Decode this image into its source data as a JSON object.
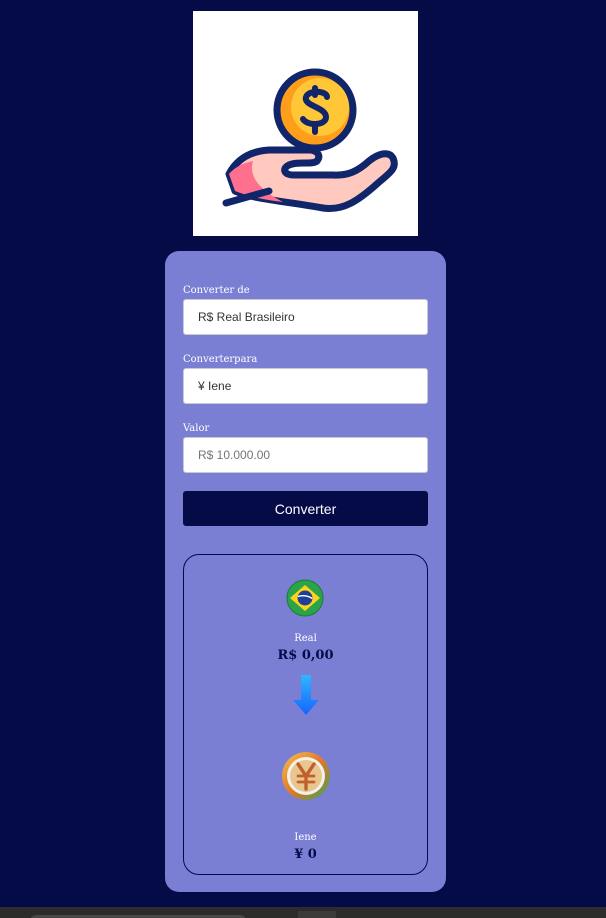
{
  "form": {
    "from_label": "Converter de",
    "from_value": "R$ Real Brasileiro",
    "to_label": "Converterpara",
    "to_value": "¥ Iene",
    "amount_label": "Valor",
    "amount_placeholder": "R$ 10.000.00",
    "convert_button": "Converter"
  },
  "result": {
    "from_currency_name": "Real",
    "from_currency_value": "R$ 0,00",
    "to_currency_name": "Iene",
    "to_currency_value": "¥ 0"
  },
  "icons": {
    "logo": "hand-holding-dollar-coin-icon",
    "from_flag": "brazil-flag-icon",
    "arrow": "arrow-down-icon",
    "to_flag": "yen-coin-icon"
  },
  "colors": {
    "background": "#050b47",
    "card": "#7a7fd4",
    "button": "#050b47",
    "arrow": "#1e8cff"
  }
}
